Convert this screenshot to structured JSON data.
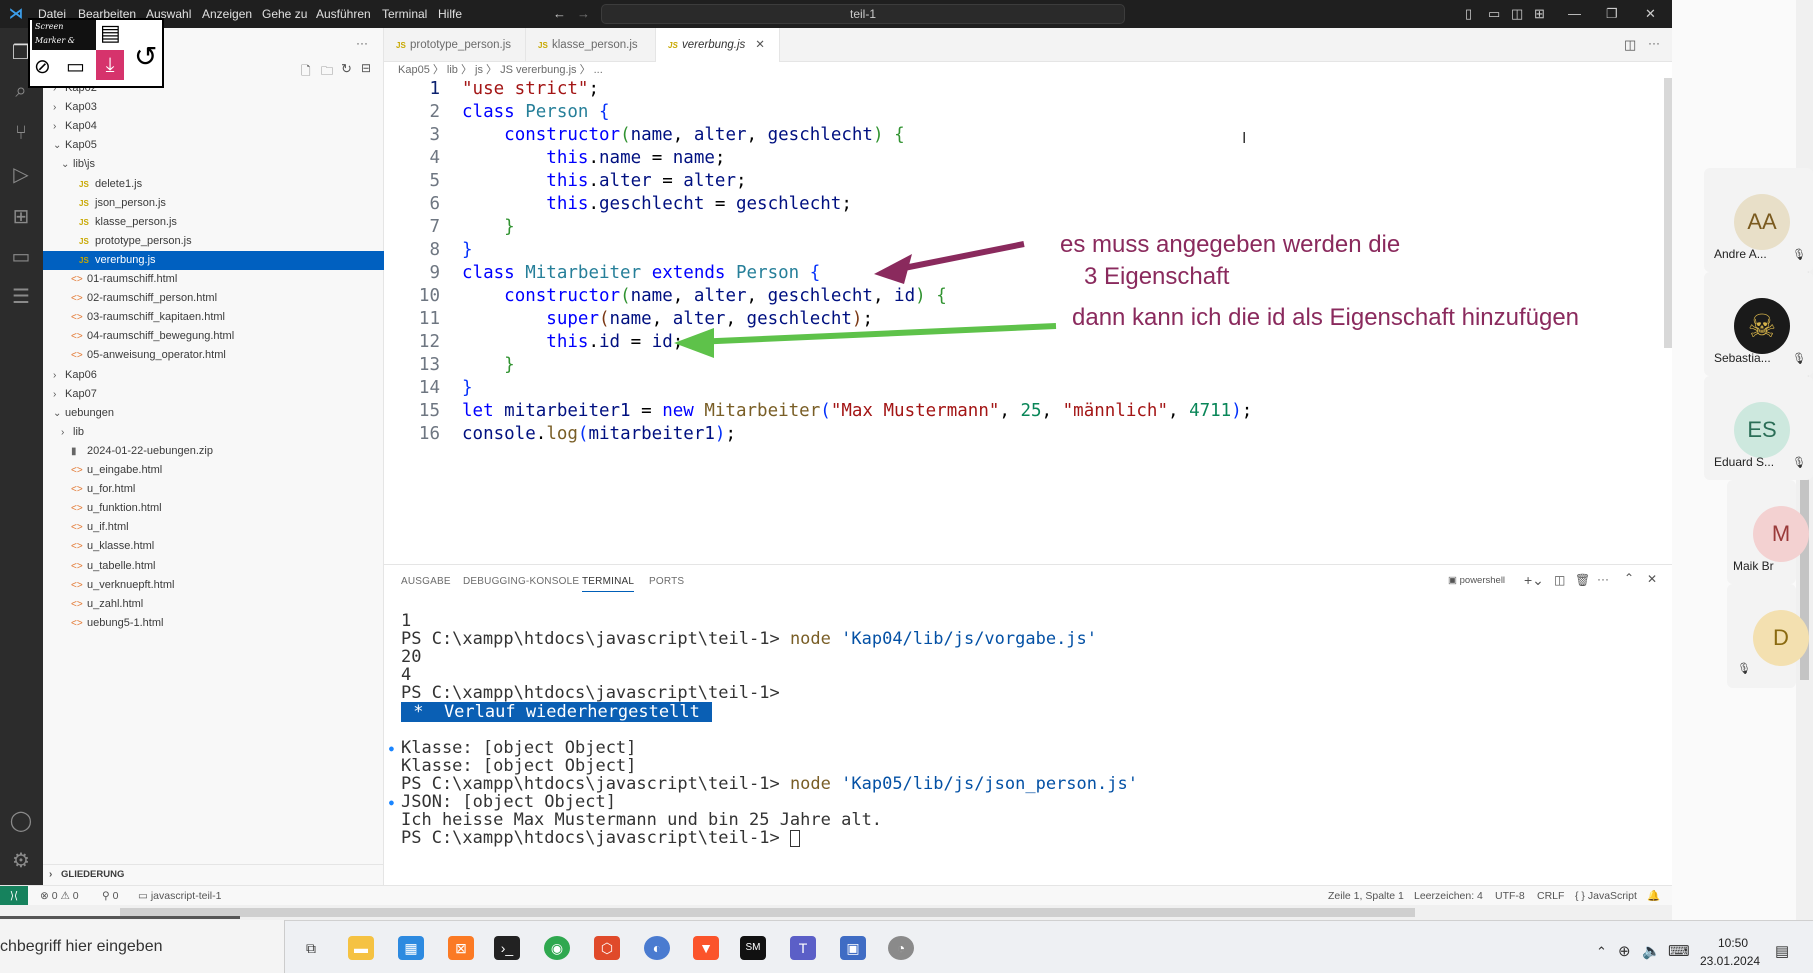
{
  "menu": [
    "Datei",
    "Bearbeiten",
    "Auswahl",
    "Anzeigen",
    "Gehe zu",
    "Ausführen",
    "Terminal",
    "Hilfe"
  ],
  "command_center": "teil-1",
  "recorder": {
    "title": "Screen Marker & Recorder"
  },
  "explorer": {
    "more": "···",
    "items": [
      {
        "label": "Kap02",
        "kind": "folder",
        "open": false
      },
      {
        "label": "Kap03",
        "kind": "folder",
        "open": false
      },
      {
        "label": "Kap04",
        "kind": "folder",
        "open": false
      },
      {
        "label": "Kap05",
        "kind": "folder",
        "open": true
      },
      {
        "label": "lib\\js",
        "kind": "folder",
        "open": true
      },
      {
        "label": "delete1.js",
        "kind": "js"
      },
      {
        "label": "json_person.js",
        "kind": "js"
      },
      {
        "label": "klasse_person.js",
        "kind": "js"
      },
      {
        "label": "prototype_person.js",
        "kind": "js"
      },
      {
        "label": "vererbung.js",
        "kind": "js",
        "selected": true
      },
      {
        "label": "01-raumschiff.html",
        "kind": "html"
      },
      {
        "label": "02-raumschiff_person.html",
        "kind": "html"
      },
      {
        "label": "03-raumschiff_kapitaen.html",
        "kind": "html"
      },
      {
        "label": "04-raumschiff_bewegung.html",
        "kind": "html"
      },
      {
        "label": "05-anweisung_operator.html",
        "kind": "html"
      },
      {
        "label": "Kap06",
        "kind": "folder",
        "open": false
      },
      {
        "label": "Kap07",
        "kind": "folder",
        "open": false
      },
      {
        "label": "uebungen",
        "kind": "folder",
        "open": true
      },
      {
        "label": "lib",
        "kind": "folder",
        "open": false
      },
      {
        "label": "2024-01-22-uebungen.zip",
        "kind": "zip"
      },
      {
        "label": "u_eingabe.html",
        "kind": "html"
      },
      {
        "label": "u_for.html",
        "kind": "html"
      },
      {
        "label": "u_funktion.html",
        "kind": "html"
      },
      {
        "label": "u_if.html",
        "kind": "html"
      },
      {
        "label": "u_klasse.html",
        "kind": "html"
      },
      {
        "label": "u_tabelle.html",
        "kind": "html"
      },
      {
        "label": "u_verknuepft.html",
        "kind": "html"
      },
      {
        "label": "u_zahl.html",
        "kind": "html"
      },
      {
        "label": "uebung5-1.html",
        "kind": "html"
      }
    ],
    "outline": "GLIEDERUNG"
  },
  "tabs": [
    {
      "label": "prototype_person.js"
    },
    {
      "label": "klasse_person.js"
    },
    {
      "label": "vererbung.js",
      "active": true
    }
  ],
  "breadcrumb": "Kap05 〉 lib 〉 js 〉 JS vererbung.js 〉 ...",
  "code_lines": [
    "1",
    "2",
    "3",
    "4",
    "5",
    "6",
    "7",
    "8",
    "9",
    "10",
    "11",
    "12",
    "13",
    "14",
    "15",
    "16"
  ],
  "annotations": {
    "a1_line1": "es muss angegeben werden die",
    "a1_line2": "3 Eigenschaft",
    "a2": "dann kann ich die id als Eigenschaft hinzufügen"
  },
  "panel": {
    "tabs": [
      "AUSGABE",
      "DEBUGGING-KONSOLE",
      "TERMINAL",
      "PORTS"
    ],
    "active_tab": "TERMINAL",
    "shell": "powershell",
    "terminal": [
      {
        "text": "1"
      },
      {
        "prompt": "PS C:\\xampp\\htdocs\\javascript\\teil-1> ",
        "cmd": "node",
        "arg": "'Kap04/lib/js/vorgabe.js'"
      },
      {
        "text": "20"
      },
      {
        "text": "4"
      },
      {
        "prompt": "PS C:\\xampp\\htdocs\\javascript\\teil-1>"
      },
      {
        "highlight": " *  Verlauf wiederhergestellt "
      },
      {
        "text": ""
      },
      {
        "text": "Klasse: [object Object]",
        "dot": true
      },
      {
        "text": "Klasse: [object Object]"
      },
      {
        "prompt": "PS C:\\xampp\\htdocs\\javascript\\teil-1> ",
        "cmd": "node",
        "arg": "'Kap05/lib/js/json_person.js'"
      },
      {
        "text": "JSON: [object Object]",
        "dot": true
      },
      {
        "text": "Ich heisse Max Mustermann und bin 25 Jahre alt."
      },
      {
        "prompt": "PS C:\\xampp\\htdocs\\javascript\\teil-1> ",
        "cursor": true
      }
    ]
  },
  "status": {
    "remote": "⟩⟨",
    "problems": "⊗ 0 ⚠ 0",
    "ports": "⚲ 0",
    "folder": "javascript-teil-1",
    "position": "Zeile 1, Spalte 1",
    "indent": "Leerzeichen: 4",
    "encoding": "UTF-8",
    "eol": "CRLF",
    "language": "{ } JavaScript"
  },
  "call": {
    "participants": [
      {
        "initials": "AA",
        "name": "Andre A...",
        "color": "#e8dfc8",
        "text": "#7a5a1f"
      },
      {
        "initials": "",
        "name": "Sebastia...",
        "color": "#1a1a1a",
        "text": "#d4b24a"
      },
      {
        "initials": "ES",
        "name": "Eduard S...",
        "color": "#cde8de",
        "text": "#2b6e57"
      },
      {
        "initials": "M",
        "name": "Maik Br",
        "color": "#f3d1d1",
        "text": "#9a3a3a"
      },
      {
        "initials": "D",
        "name": "",
        "color": "#f3e0b0",
        "text": "#8a6a10"
      }
    ]
  },
  "taskbar": {
    "search": "chbegriff hier eingeben",
    "time": "10:50",
    "date": "23.01.2024"
  }
}
